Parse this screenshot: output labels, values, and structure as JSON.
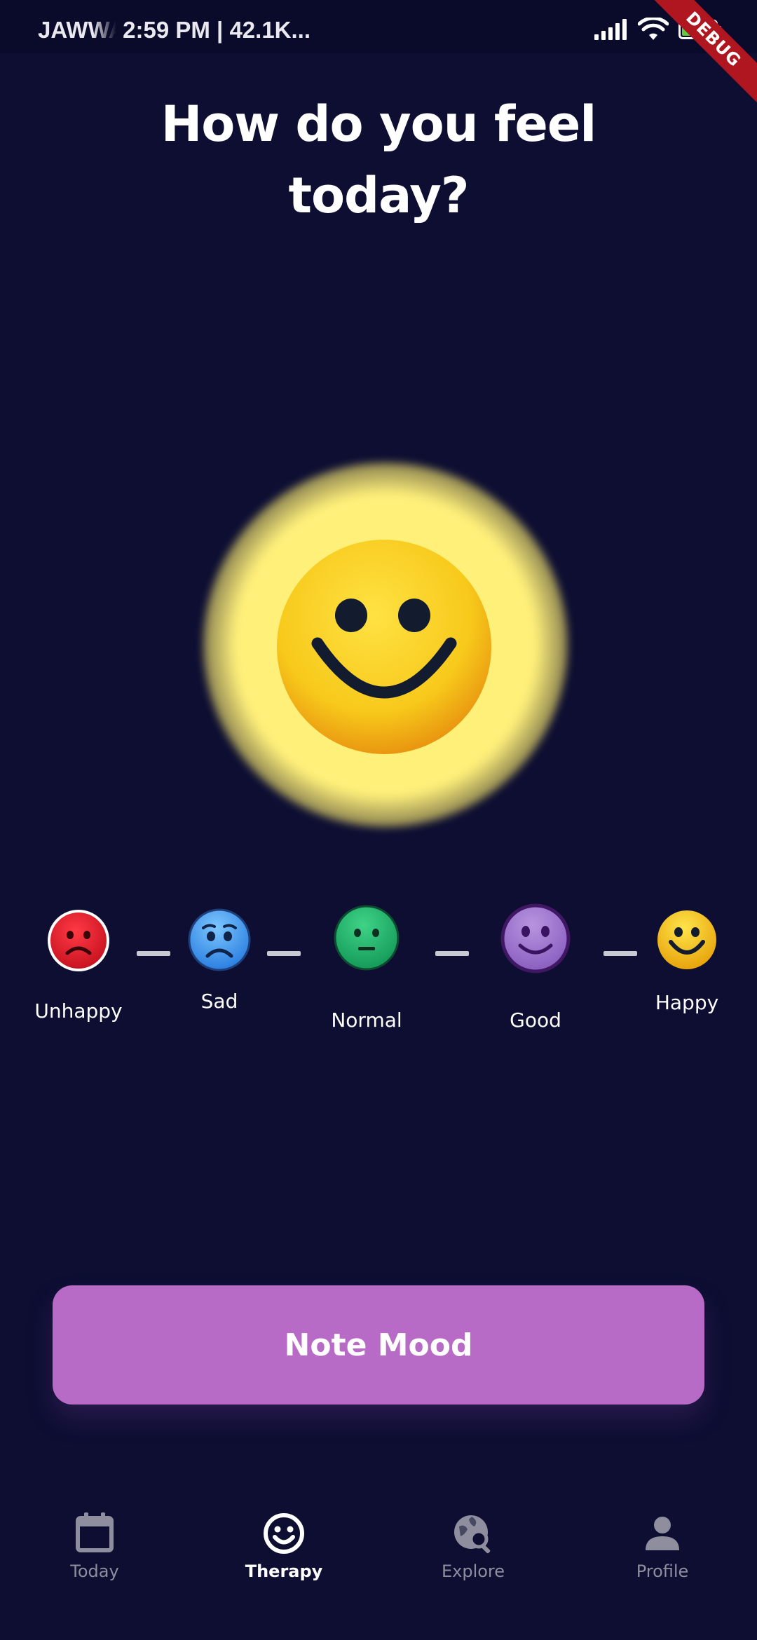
{
  "status_bar": {
    "carrier": "JAWWAL",
    "time_info": "2:59 PM | 42.1K...",
    "battery_level": "94",
    "icons": [
      "signal-icon",
      "wifi-icon",
      "battery-icon"
    ]
  },
  "debug_banner": "DEBUG",
  "title": "How do you feel today?",
  "selected_mood": "Happy",
  "moods": [
    {
      "label": "Unhappy",
      "icon": "unhappy-face-icon",
      "color": "#e2182a"
    },
    {
      "label": "Sad",
      "icon": "sad-face-icon",
      "color": "#3d9bf2"
    },
    {
      "label": "Normal",
      "icon": "neutral-face-icon",
      "color": "#1fb86d"
    },
    {
      "label": "Good",
      "icon": "good-face-icon",
      "color": "#a47ad0"
    },
    {
      "label": "Happy",
      "icon": "happy-face-icon",
      "color": "#f8c80e"
    }
  ],
  "button": {
    "label": "Note Mood",
    "color": "#b86bc6"
  },
  "nav": {
    "items": [
      {
        "label": "Today",
        "icon": "calendar-icon",
        "active": false
      },
      {
        "label": "Therapy",
        "icon": "smiley-icon",
        "active": true
      },
      {
        "label": "Explore",
        "icon": "globe-search-icon",
        "active": false
      },
      {
        "label": "Profile",
        "icon": "person-icon",
        "active": false
      }
    ]
  },
  "colors": {
    "background": "#0d0e32",
    "accent": "#b86bc6",
    "glow": "#fff07a"
  }
}
